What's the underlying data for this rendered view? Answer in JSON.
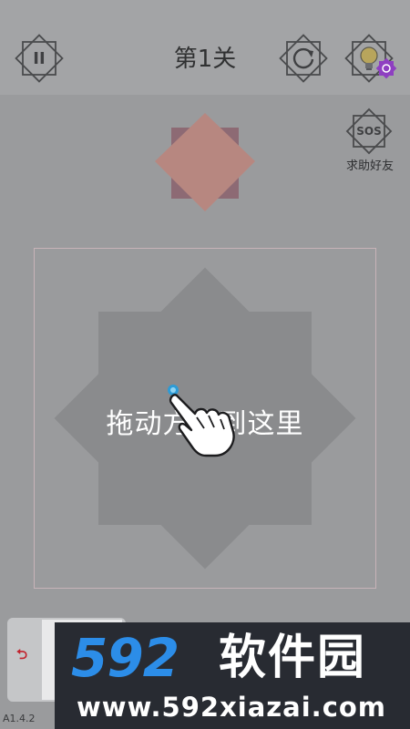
{
  "header": {
    "level_title": "第1关",
    "pause_icon": "pause-icon",
    "pause_glyph": "II",
    "restart_icon": "restart-icon",
    "hint_icon": "lightbulb-icon",
    "hint_badge_color": "#8e3fc1"
  },
  "sos": {
    "glyph": "SOS",
    "label": "求助好友"
  },
  "target": {
    "square_color": "#8d6a74",
    "diamond_color": "#b78780"
  },
  "board": {
    "frame_color": "#c7b3b8",
    "shape_color": "#8a8b8d",
    "instruction": "拖动方块到这里",
    "hand_icon": "hand-pointer-icon"
  },
  "bottom": {
    "undo_glyph": "⮌",
    "version": "A1.4.2"
  },
  "watermark": {
    "brand_number": "592",
    "brand_name": "软件园",
    "url": "www.592xiazai.com"
  }
}
